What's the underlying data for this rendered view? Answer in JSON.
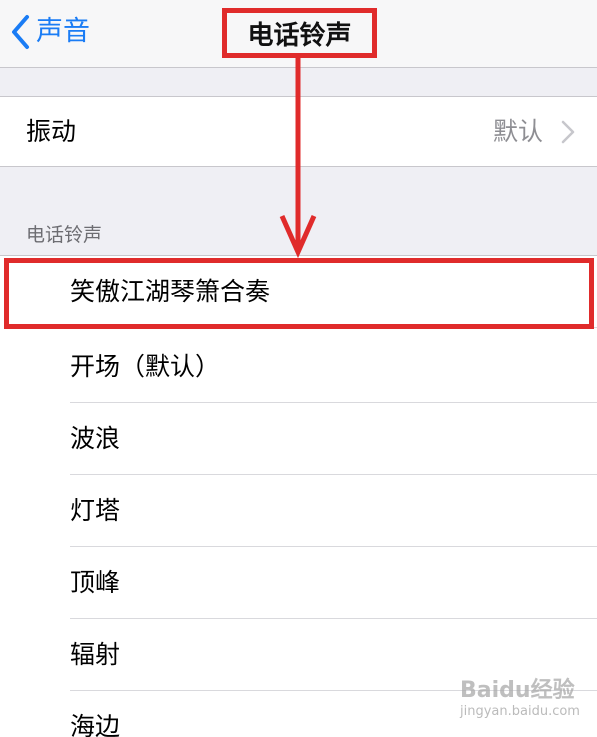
{
  "navbar": {
    "back_label": "声音",
    "title": "电话铃声"
  },
  "vibration": {
    "label": "振动",
    "value": "默认"
  },
  "ringtones": {
    "section_header": "电话铃声",
    "items": [
      {
        "label": "笑傲江湖琴箫合奏"
      },
      {
        "label": "开场（默认）"
      },
      {
        "label": "波浪"
      },
      {
        "label": "灯塔"
      },
      {
        "label": "顶峰"
      },
      {
        "label": "辐射"
      },
      {
        "label": "海边"
      }
    ]
  },
  "watermark": {
    "brand": "Baidu经验",
    "url": "jingyan.baidu.com"
  },
  "colors": {
    "accent": "#1a7cf5",
    "annotation": "#e02b2b"
  }
}
